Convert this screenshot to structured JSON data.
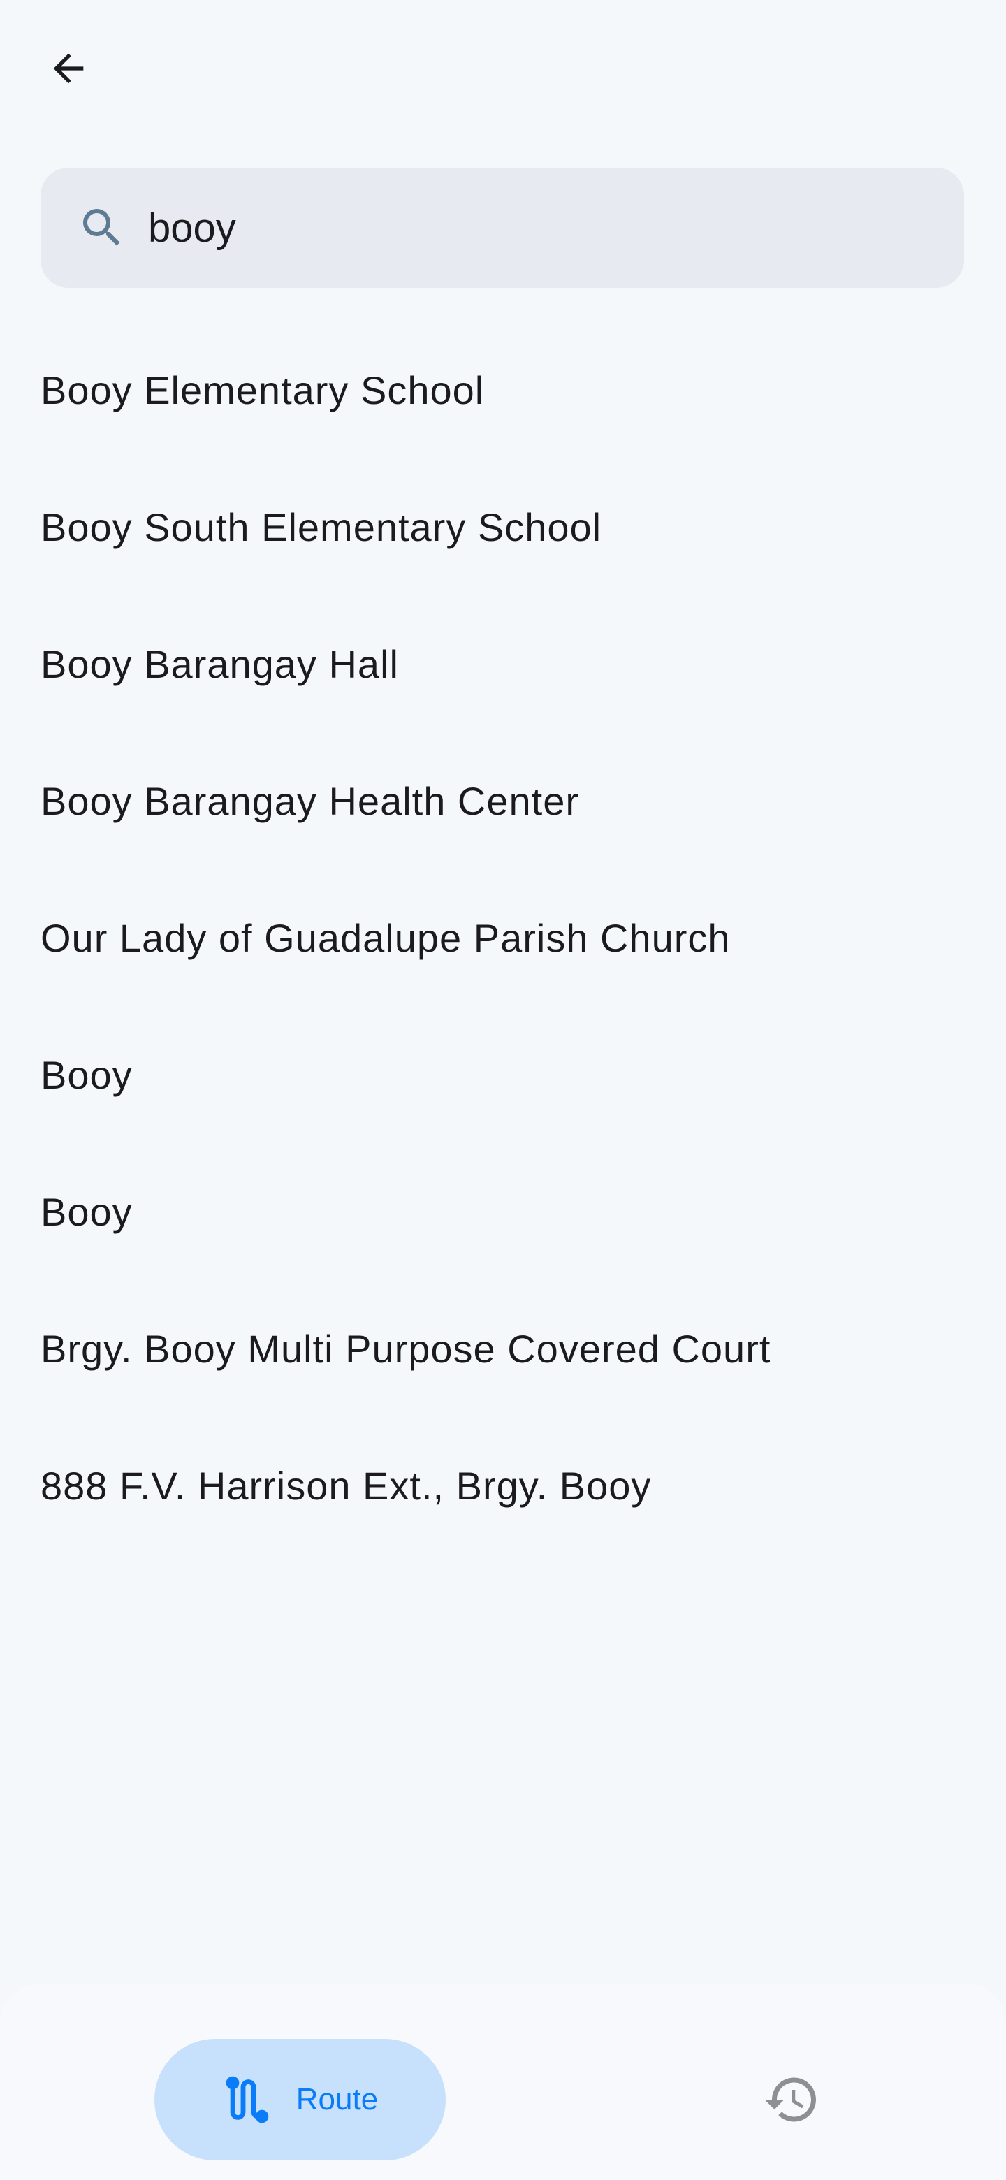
{
  "header": {
    "back_icon": "arrow-left-icon"
  },
  "search": {
    "value": "booy",
    "icon": "search-icon"
  },
  "results": [
    "Booy Elementary School",
    "Booy South Elementary School",
    "Booy Barangay Hall",
    "Booy Barangay Health Center",
    "Our Lady of Guadalupe Parish Church",
    "Booy",
    "Booy",
    "Brgy. Booy Multi Purpose Covered Court",
    "888 F.V. Harrison Ext., Brgy. Booy"
  ],
  "nav": {
    "route_label": "Route",
    "route_icon": "route-icon",
    "history_icon": "history-icon",
    "accent": "#0a7cf8"
  }
}
